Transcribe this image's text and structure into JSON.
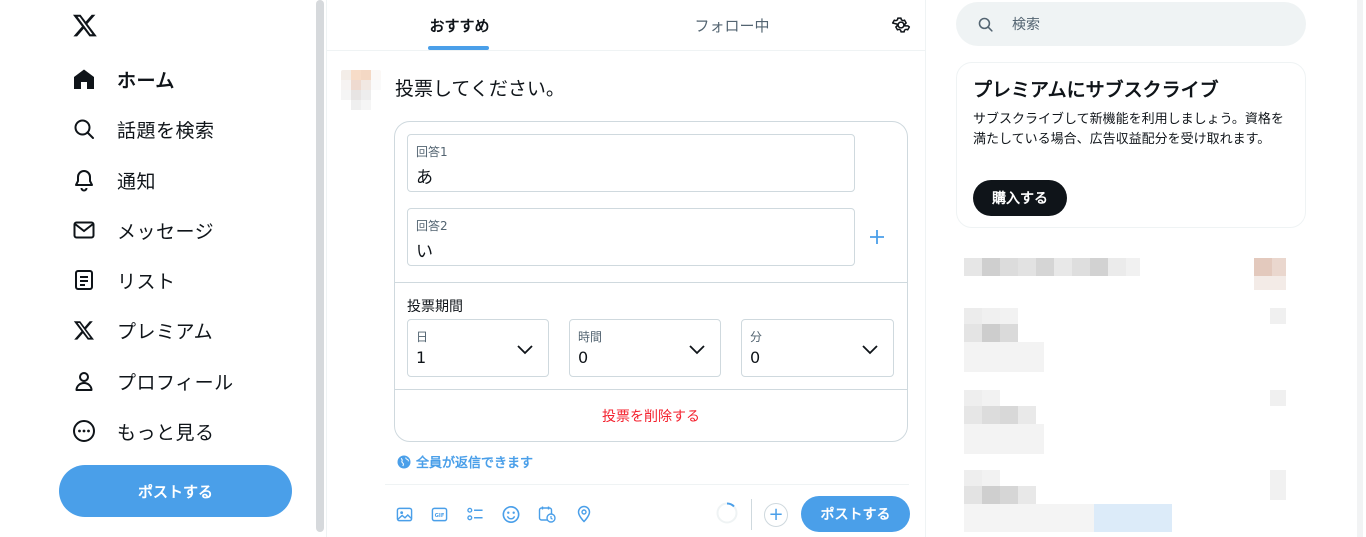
{
  "sidebar": {
    "logo": "x-logo-icon",
    "items": [
      {
        "label": "ホーム",
        "icon": "home-icon",
        "active": true
      },
      {
        "label": "話題を検索",
        "icon": "search-icon"
      },
      {
        "label": "通知",
        "icon": "bell-icon"
      },
      {
        "label": "メッセージ",
        "icon": "mail-icon"
      },
      {
        "label": "リスト",
        "icon": "list-icon"
      },
      {
        "label": "プレミアム",
        "icon": "x-logo-icon"
      },
      {
        "label": "プロフィール",
        "icon": "person-icon"
      },
      {
        "label": "もっと見る",
        "icon": "more-circle-icon"
      }
    ],
    "post_button": "ポストする"
  },
  "main": {
    "tabs": [
      {
        "label": "おすすめ",
        "active": true
      },
      {
        "label": "フォロー中"
      }
    ],
    "composer": {
      "placeholder": "投票してください。",
      "poll": {
        "choices": [
          {
            "label": "回答1",
            "value": "あ"
          },
          {
            "label": "回答2",
            "value": "い"
          }
        ],
        "duration_label": "投票期間",
        "duration": [
          {
            "label": "日",
            "value": "1"
          },
          {
            "label": "時間",
            "value": "0"
          },
          {
            "label": "分",
            "value": "0"
          }
        ],
        "remove_label": "投票を削除する"
      },
      "reply_setting": "全員が返信できます",
      "tools": [
        "image-icon",
        "gif-icon",
        "poll-icon",
        "emoji-icon",
        "schedule-icon",
        "location-icon"
      ],
      "submit": "ポストする"
    }
  },
  "right": {
    "search_placeholder": "検索",
    "premium": {
      "title": "プレミアムにサブスクライブ",
      "description": "サブスクライブして新機能を利用しましょう。資格を満たしている場合、広告収益配分を受け取れます。",
      "button": "購入する"
    }
  },
  "colors": {
    "accent": "#4a9fe9",
    "danger": "#f4212e",
    "text": "#0f1419",
    "muted": "#536471",
    "border": "#cfd9de"
  }
}
